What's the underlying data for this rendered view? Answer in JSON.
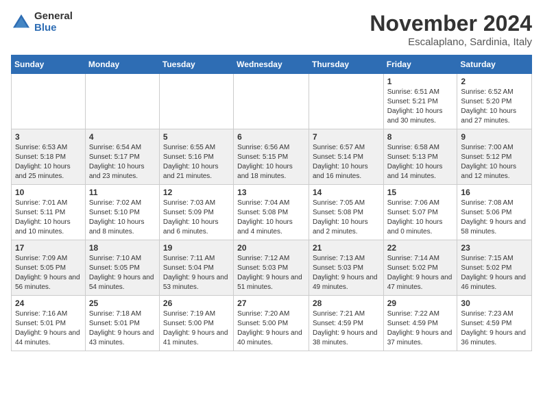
{
  "header": {
    "logo_general": "General",
    "logo_blue": "Blue",
    "month": "November 2024",
    "location": "Escalaplano, Sardinia, Italy"
  },
  "weekdays": [
    "Sunday",
    "Monday",
    "Tuesday",
    "Wednesday",
    "Thursday",
    "Friday",
    "Saturday"
  ],
  "weeks": [
    [
      {
        "day": "",
        "info": ""
      },
      {
        "day": "",
        "info": ""
      },
      {
        "day": "",
        "info": ""
      },
      {
        "day": "",
        "info": ""
      },
      {
        "day": "",
        "info": ""
      },
      {
        "day": "1",
        "info": "Sunrise: 6:51 AM\nSunset: 5:21 PM\nDaylight: 10 hours and 30 minutes."
      },
      {
        "day": "2",
        "info": "Sunrise: 6:52 AM\nSunset: 5:20 PM\nDaylight: 10 hours and 27 minutes."
      }
    ],
    [
      {
        "day": "3",
        "info": "Sunrise: 6:53 AM\nSunset: 5:18 PM\nDaylight: 10 hours and 25 minutes."
      },
      {
        "day": "4",
        "info": "Sunrise: 6:54 AM\nSunset: 5:17 PM\nDaylight: 10 hours and 23 minutes."
      },
      {
        "day": "5",
        "info": "Sunrise: 6:55 AM\nSunset: 5:16 PM\nDaylight: 10 hours and 21 minutes."
      },
      {
        "day": "6",
        "info": "Sunrise: 6:56 AM\nSunset: 5:15 PM\nDaylight: 10 hours and 18 minutes."
      },
      {
        "day": "7",
        "info": "Sunrise: 6:57 AM\nSunset: 5:14 PM\nDaylight: 10 hours and 16 minutes."
      },
      {
        "day": "8",
        "info": "Sunrise: 6:58 AM\nSunset: 5:13 PM\nDaylight: 10 hours and 14 minutes."
      },
      {
        "day": "9",
        "info": "Sunrise: 7:00 AM\nSunset: 5:12 PM\nDaylight: 10 hours and 12 minutes."
      }
    ],
    [
      {
        "day": "10",
        "info": "Sunrise: 7:01 AM\nSunset: 5:11 PM\nDaylight: 10 hours and 10 minutes."
      },
      {
        "day": "11",
        "info": "Sunrise: 7:02 AM\nSunset: 5:10 PM\nDaylight: 10 hours and 8 minutes."
      },
      {
        "day": "12",
        "info": "Sunrise: 7:03 AM\nSunset: 5:09 PM\nDaylight: 10 hours and 6 minutes."
      },
      {
        "day": "13",
        "info": "Sunrise: 7:04 AM\nSunset: 5:08 PM\nDaylight: 10 hours and 4 minutes."
      },
      {
        "day": "14",
        "info": "Sunrise: 7:05 AM\nSunset: 5:08 PM\nDaylight: 10 hours and 2 minutes."
      },
      {
        "day": "15",
        "info": "Sunrise: 7:06 AM\nSunset: 5:07 PM\nDaylight: 10 hours and 0 minutes."
      },
      {
        "day": "16",
        "info": "Sunrise: 7:08 AM\nSunset: 5:06 PM\nDaylight: 9 hours and 58 minutes."
      }
    ],
    [
      {
        "day": "17",
        "info": "Sunrise: 7:09 AM\nSunset: 5:05 PM\nDaylight: 9 hours and 56 minutes."
      },
      {
        "day": "18",
        "info": "Sunrise: 7:10 AM\nSunset: 5:05 PM\nDaylight: 9 hours and 54 minutes."
      },
      {
        "day": "19",
        "info": "Sunrise: 7:11 AM\nSunset: 5:04 PM\nDaylight: 9 hours and 53 minutes."
      },
      {
        "day": "20",
        "info": "Sunrise: 7:12 AM\nSunset: 5:03 PM\nDaylight: 9 hours and 51 minutes."
      },
      {
        "day": "21",
        "info": "Sunrise: 7:13 AM\nSunset: 5:03 PM\nDaylight: 9 hours and 49 minutes."
      },
      {
        "day": "22",
        "info": "Sunrise: 7:14 AM\nSunset: 5:02 PM\nDaylight: 9 hours and 47 minutes."
      },
      {
        "day": "23",
        "info": "Sunrise: 7:15 AM\nSunset: 5:02 PM\nDaylight: 9 hours and 46 minutes."
      }
    ],
    [
      {
        "day": "24",
        "info": "Sunrise: 7:16 AM\nSunset: 5:01 PM\nDaylight: 9 hours and 44 minutes."
      },
      {
        "day": "25",
        "info": "Sunrise: 7:18 AM\nSunset: 5:01 PM\nDaylight: 9 hours and 43 minutes."
      },
      {
        "day": "26",
        "info": "Sunrise: 7:19 AM\nSunset: 5:00 PM\nDaylight: 9 hours and 41 minutes."
      },
      {
        "day": "27",
        "info": "Sunrise: 7:20 AM\nSunset: 5:00 PM\nDaylight: 9 hours and 40 minutes."
      },
      {
        "day": "28",
        "info": "Sunrise: 7:21 AM\nSunset: 4:59 PM\nDaylight: 9 hours and 38 minutes."
      },
      {
        "day": "29",
        "info": "Sunrise: 7:22 AM\nSunset: 4:59 PM\nDaylight: 9 hours and 37 minutes."
      },
      {
        "day": "30",
        "info": "Sunrise: 7:23 AM\nSunset: 4:59 PM\nDaylight: 9 hours and 36 minutes."
      }
    ]
  ]
}
